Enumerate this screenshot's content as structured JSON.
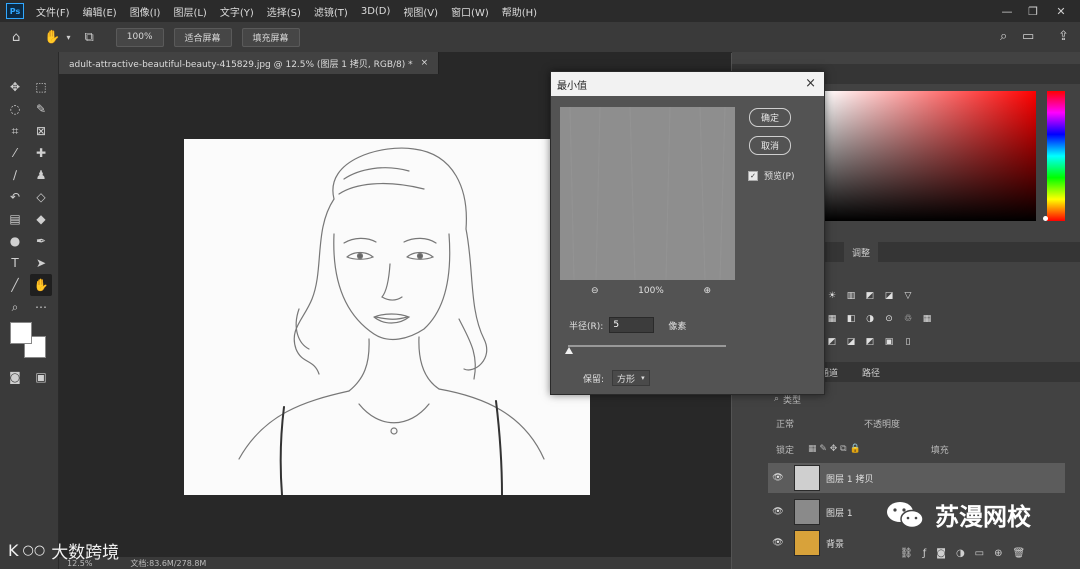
{
  "menu": [
    "文件(F)",
    "编辑(E)",
    "图像(I)",
    "图层(L)",
    "文字(Y)",
    "选择(S)",
    "滤镜(T)",
    "3D(D)",
    "视图(V)",
    "窗口(W)",
    "帮助(H)"
  ],
  "options_bar": {
    "zoom": "100%",
    "fit_screen": "适合屏幕",
    "fill_screen": "填充屏幕"
  },
  "document": {
    "tab_title": "adult-attractive-beautiful-beauty-415829.jpg @ 12.5% (图层 1 拷贝, RGB/8) *",
    "close": "×"
  },
  "status": {
    "zoom": "12.5%",
    "doc_info": "文档:83.6M/278.8M"
  },
  "dialog": {
    "title": "最小值",
    "close": "×",
    "ok": "确定",
    "cancel": "取消",
    "preview_label": "预览(P)",
    "preview_checked": true,
    "preview_zoom": "100%",
    "radius_label": "半径(R):",
    "radius_value": "5",
    "radius_unit": "像素",
    "preserve_label": "保留:",
    "preserve_value": "方形"
  },
  "panels": {
    "adjustments_tab": "调整",
    "layers_tabs": [
      "通道",
      "路径"
    ],
    "search_placeholder": "类型",
    "blend_mode": "正常",
    "opacity_label": "不透明度",
    "lock_label": "锁定",
    "fill_label": "填充"
  },
  "layers": [
    {
      "name": "图层 1 拷贝",
      "selected": true,
      "thumb_color": "#cfcfcf"
    },
    {
      "name": "图层 1",
      "selected": false,
      "thumb_color": "#8a8a8a"
    },
    {
      "name": "背景",
      "selected": false,
      "thumb_color": "#d8a23a"
    }
  ],
  "watermarks": {
    "left": "大数跨境",
    "left_logo": "K",
    "right": "苏漫网校"
  },
  "colors": {
    "accent": "#31a8ff",
    "dialog_bg": "#535353",
    "app_bg": "#282828"
  }
}
